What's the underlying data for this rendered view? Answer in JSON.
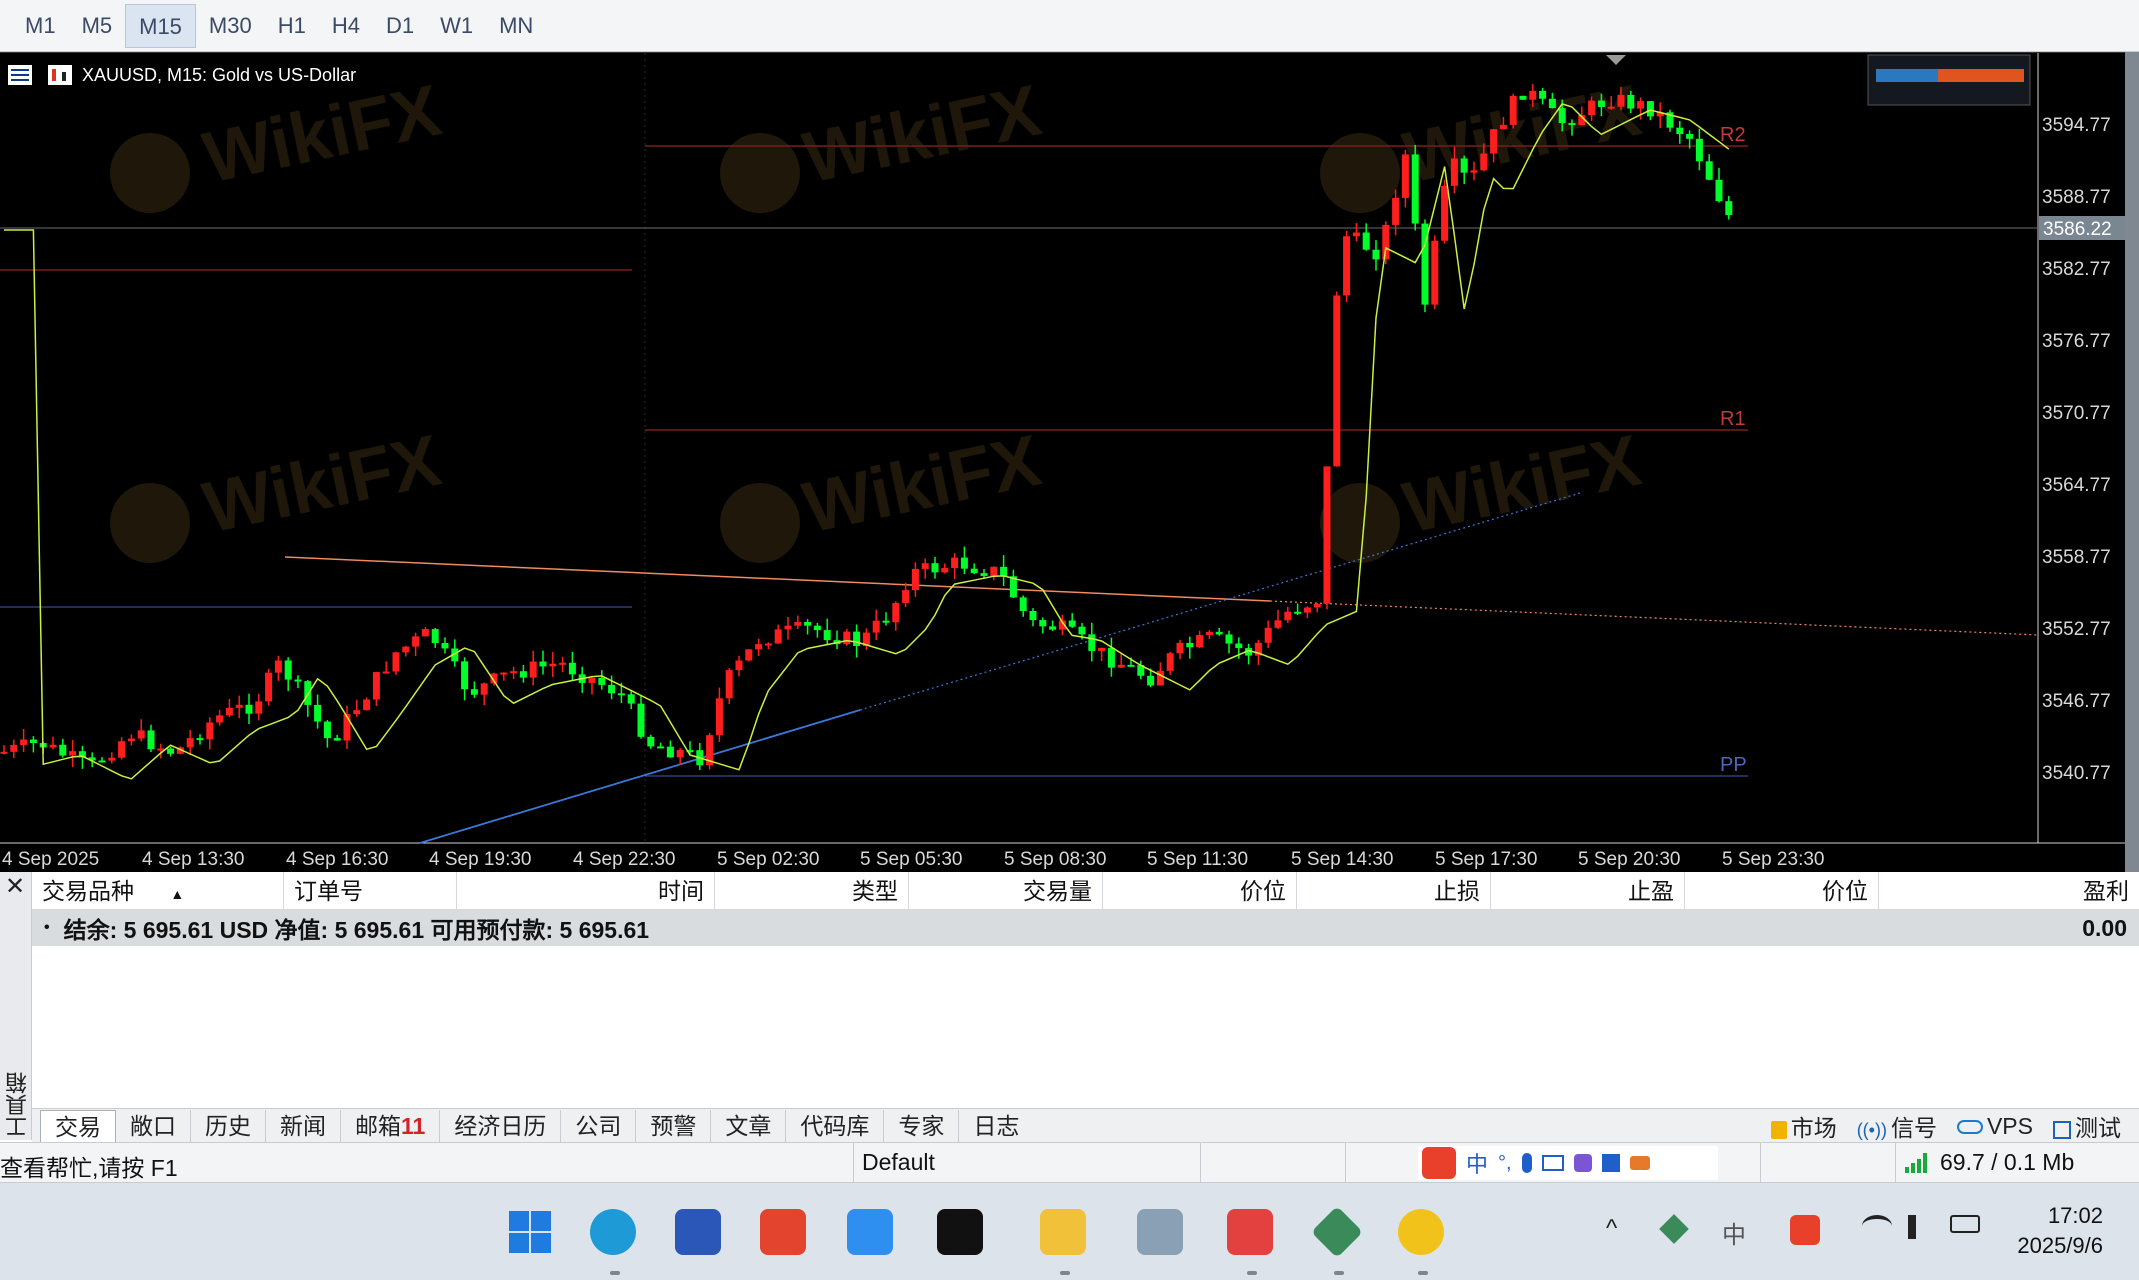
{
  "timeframes": [
    "M1",
    "M5",
    "M15",
    "M30",
    "H1",
    "H4",
    "D1",
    "W1",
    "MN"
  ],
  "active_timeframe": "M15",
  "chart": {
    "symbol_title": "XAUUSD, M15:  Gold vs US-Dollar",
    "current_price": "3586.22",
    "price_levels": [
      "3594.77",
      "3588.77",
      "3582.77",
      "3576.77",
      "3570.77",
      "3564.77",
      "3558.77",
      "3552.77",
      "3546.77",
      "3540.77"
    ],
    "time_labels": [
      "4 Sep 2025",
      "4 Sep 13:30",
      "4 Sep 16:30",
      "4 Sep 19:30",
      "4 Sep 22:30",
      "5 Sep 02:30",
      "5 Sep 05:30",
      "5 Sep 08:30",
      "5 Sep 11:30",
      "5 Sep 14:30",
      "5 Sep 17:30",
      "5 Sep 20:30",
      "5 Sep 23:30"
    ],
    "pivot_labels": {
      "r2": "R2",
      "r1": "R1",
      "pp": "PP"
    },
    "watermark": "WikiFX",
    "colors": {
      "bull": "#ff1e1e",
      "bear": "#00ff2a",
      "ma": "#c8f040",
      "trend_up": "#3a78d8",
      "trend_down": "#f08a60",
      "background": "#000000"
    }
  },
  "terminal": {
    "close": "✕",
    "side_label": "工具箱",
    "columns": [
      "交易品种",
      "订单号",
      "时间",
      "类型",
      "交易量",
      "价位",
      "止损",
      "止盈",
      "价位",
      "盈利"
    ],
    "sort_indicator": "▲",
    "balance_bullet": "•",
    "balance_line": "结余: 5 695.61 USD  净值: 5 695.61  可用预付款: 5 695.61",
    "profit_total": "0.00",
    "tabs": [
      "交易",
      "敞口",
      "历史",
      "新闻",
      "邮箱",
      "经济日历",
      "公司",
      "预警",
      "文章",
      "代码库",
      "专家",
      "日志"
    ],
    "mail_count": "11",
    "active_tab": "交易",
    "right_items": {
      "market": "市场",
      "signals": "信号",
      "vps": "VPS",
      "tester": "测试"
    }
  },
  "statusbar": {
    "help": "查看帮忙,请按 F1",
    "profile": "Default",
    "connection": "69.7 / 0.1 Mb",
    "ime_lang": "中"
  },
  "taskbar": {
    "time": "17:02",
    "date": "2025/9/6",
    "tray_lang": "中",
    "caret": "^"
  }
}
